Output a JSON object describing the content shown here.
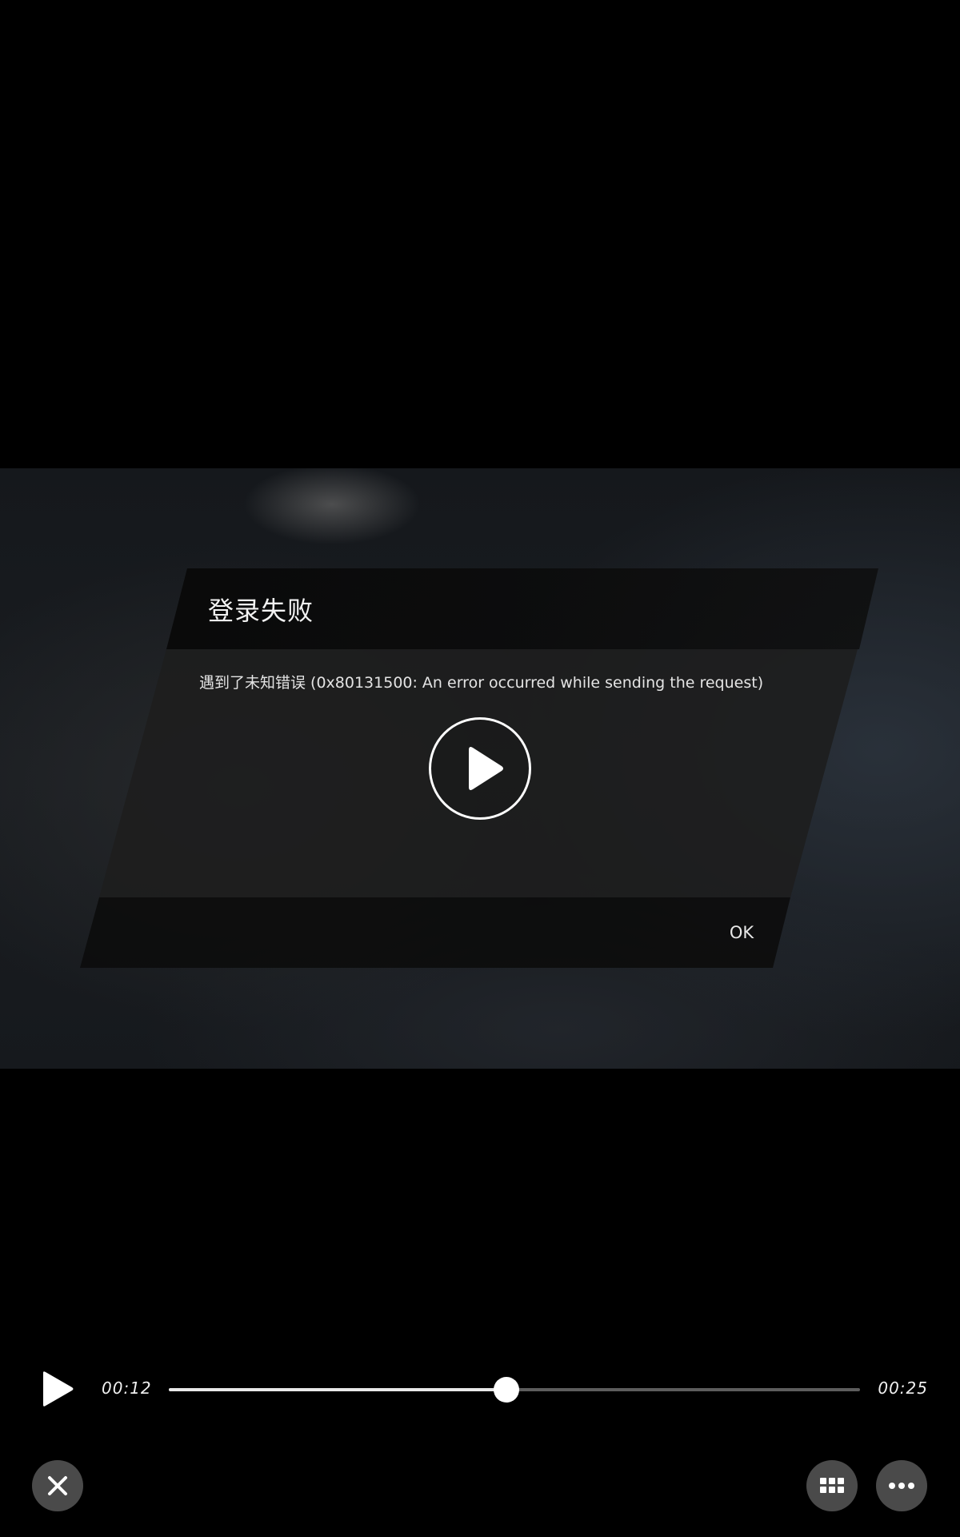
{
  "dialog": {
    "title": "登录失败",
    "message": "遇到了未知错误 (0x80131500: An error occurred while sending the request)",
    "ok_label": "OK"
  },
  "player": {
    "elapsed": "00:12",
    "duration": "00:25",
    "progress_fraction": 0.488,
    "state": "paused"
  },
  "icons": {
    "center_play": "play-circle-icon",
    "play": "play-icon",
    "close": "close-icon",
    "grid": "grid-icon",
    "more": "more-horizontal-icon"
  },
  "colors": {
    "background": "#000000",
    "track": "#5d5d5d",
    "track_fill": "#e8e8e8",
    "button_bg": "#4a4a4a"
  }
}
